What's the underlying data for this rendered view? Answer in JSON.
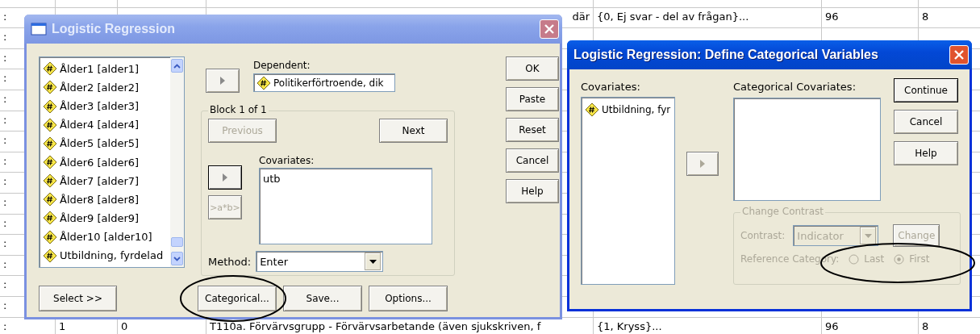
{
  "spreadsheet": {
    "rows": [
      {},
      {
        "marker": ":",
        "cells": {
          "column_3": "där",
          "column_4": "{0, Ej svar - del av frågan}...",
          "column_5": "96",
          "column_6": "8"
        }
      },
      {
        "marker": ":"
      },
      {
        "marker": ":"
      },
      {
        "marker": ":"
      },
      {
        "marker": ":"
      },
      {
        "marker": ":"
      },
      {
        "marker": ":"
      },
      {
        "marker": ":"
      },
      {
        "marker": ":"
      },
      {
        "marker": ":"
      },
      {
        "marker": ":"
      },
      {
        "marker": ":"
      },
      {
        "marker": ":"
      },
      {
        "marker": ":"
      },
      {
        "marker": ":"
      },
      {
        "marker": ":",
        "cells": {
          "column_1": "1",
          "column_2": "0",
          "column_3": "T110a. Förvärvsgrupp - Förvärvsarbetande (även sjukskriven, f",
          "column_4": "{1, Kryss}...",
          "column_5": "96",
          "column_6": "8"
        }
      }
    ]
  },
  "regression_dialog": {
    "title": "Logistic Regression",
    "active": false,
    "variables": [
      "Ålder1 [alder1]",
      "Ålder2 [alder2]",
      "Ålder3 [alder3]",
      "Ålder4 [alder4]",
      "Ålder5 [alder5]",
      "Ålder6 [alder6]",
      "Ålder7 [alder7]",
      "Ålder8 [alder8]",
      "Ålder9 [alder9]",
      "Ålder10 [alder10]",
      "Utbildning, fyrdelad"
    ],
    "dependent": {
      "label": "Dependent:",
      "value": "Politikerförtroende, dik"
    },
    "block": {
      "label": "Block 1 of 1",
      "buttons": [
        {
          "label": "Previous",
          "disabled": true
        },
        {
          "label": "Next",
          "disabled": false
        }
      ]
    },
    "covariates": {
      "label": "Covariates:",
      "items": [
        "utb"
      ]
    },
    "interaction_button": {
      "label": ">a*b>",
      "disabled": true
    },
    "method": {
      "label": "Method:",
      "value": "Enter"
    },
    "side_buttons": [
      "OK",
      "Paste",
      "Reset",
      "Cancel",
      "Help"
    ],
    "bottom_buttons": [
      "Select >>",
      "Categorical...",
      "Save...",
      "Options..."
    ]
  },
  "categorical_dialog": {
    "title": "Logistic Regression: Define Categorical Variables",
    "active": true,
    "covariates": {
      "label": "Covariates:",
      "items": [
        "Utbildning, fyr"
      ]
    },
    "categorical_covariates": {
      "label": "Categorical Covariates:"
    },
    "buttons": [
      {
        "label": "Continue",
        "default": true
      },
      {
        "label": "Cancel",
        "default": false
      },
      {
        "label": "Help",
        "default": false
      }
    ],
    "change_contrast": {
      "label": "Change Contrast",
      "disabled": true,
      "contrast_label": "Contrast:",
      "contrast_value": "Indicator",
      "change_button": "Change",
      "reference_label": "Reference Category:",
      "options": [
        {
          "label": "Last",
          "selected": false
        },
        {
          "label": "First",
          "selected": true
        }
      ]
    }
  }
}
